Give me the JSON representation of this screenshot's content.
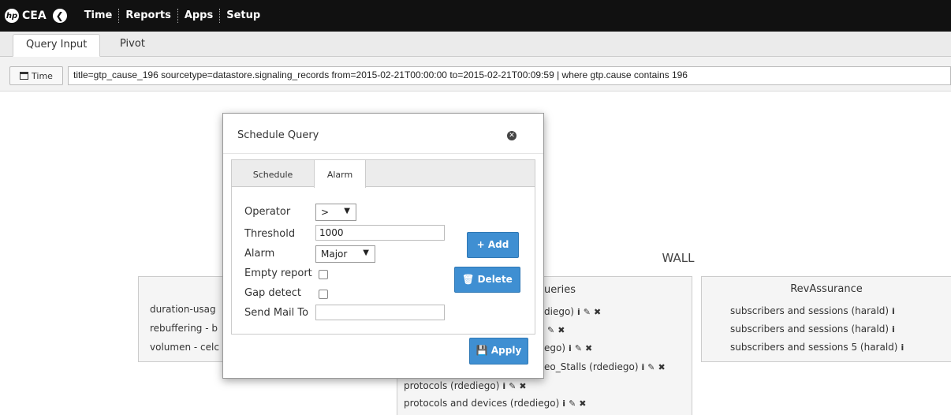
{
  "app": {
    "logo_mark": "hp",
    "logo_text": "CEA",
    "menu": [
      "Time",
      "Reports",
      "Apps",
      "Setup"
    ]
  },
  "tabs": [
    "Query Input",
    "Pivot"
  ],
  "query": {
    "time_button": "Time",
    "text": "title=gtp_cause_196 sourcetype=datastore.signaling_records from=2015-02-21T00:00:00 to=2015-02-21T00:09:59 | where gtp.cause contains 196"
  },
  "wall": {
    "title": "WALL",
    "left_panel": {
      "rows": [
        "duration-usag",
        "rebuffering - b",
        "volumen - celc"
      ]
    },
    "middle_panel": {
      "title_fragment": "ueries",
      "rows": [
        "diego)",
        "",
        "ego)",
        "eo_Stalls (rdediego)",
        "protocols (rdediego)",
        "protocols and devices (rdediego)"
      ]
    },
    "right_panel": {
      "title": "RevAssurance",
      "rows": [
        "subscribers and sessions (harald)",
        "subscribers and sessions (harald)",
        "subscribers and sessions 5 (harald)"
      ]
    }
  },
  "modal": {
    "title": "Schedule Query",
    "tabs": [
      "Schedule",
      "Alarm"
    ],
    "active_tab": "Alarm",
    "form": {
      "operator_label": "Operator",
      "operator_value": ">",
      "threshold_label": "Threshold",
      "threshold_value": "1000",
      "alarm_label": "Alarm",
      "alarm_value": "Major",
      "empty_report_label": "Empty report",
      "gap_detect_label": "Gap detect",
      "send_mail_label": "Send Mail To",
      "send_mail_value": ""
    },
    "buttons": {
      "add": "Add",
      "delete": "Delete",
      "apply": "Apply"
    }
  },
  "colors": {
    "topbar": "#111111",
    "button_blue": "#3f8fd2"
  }
}
